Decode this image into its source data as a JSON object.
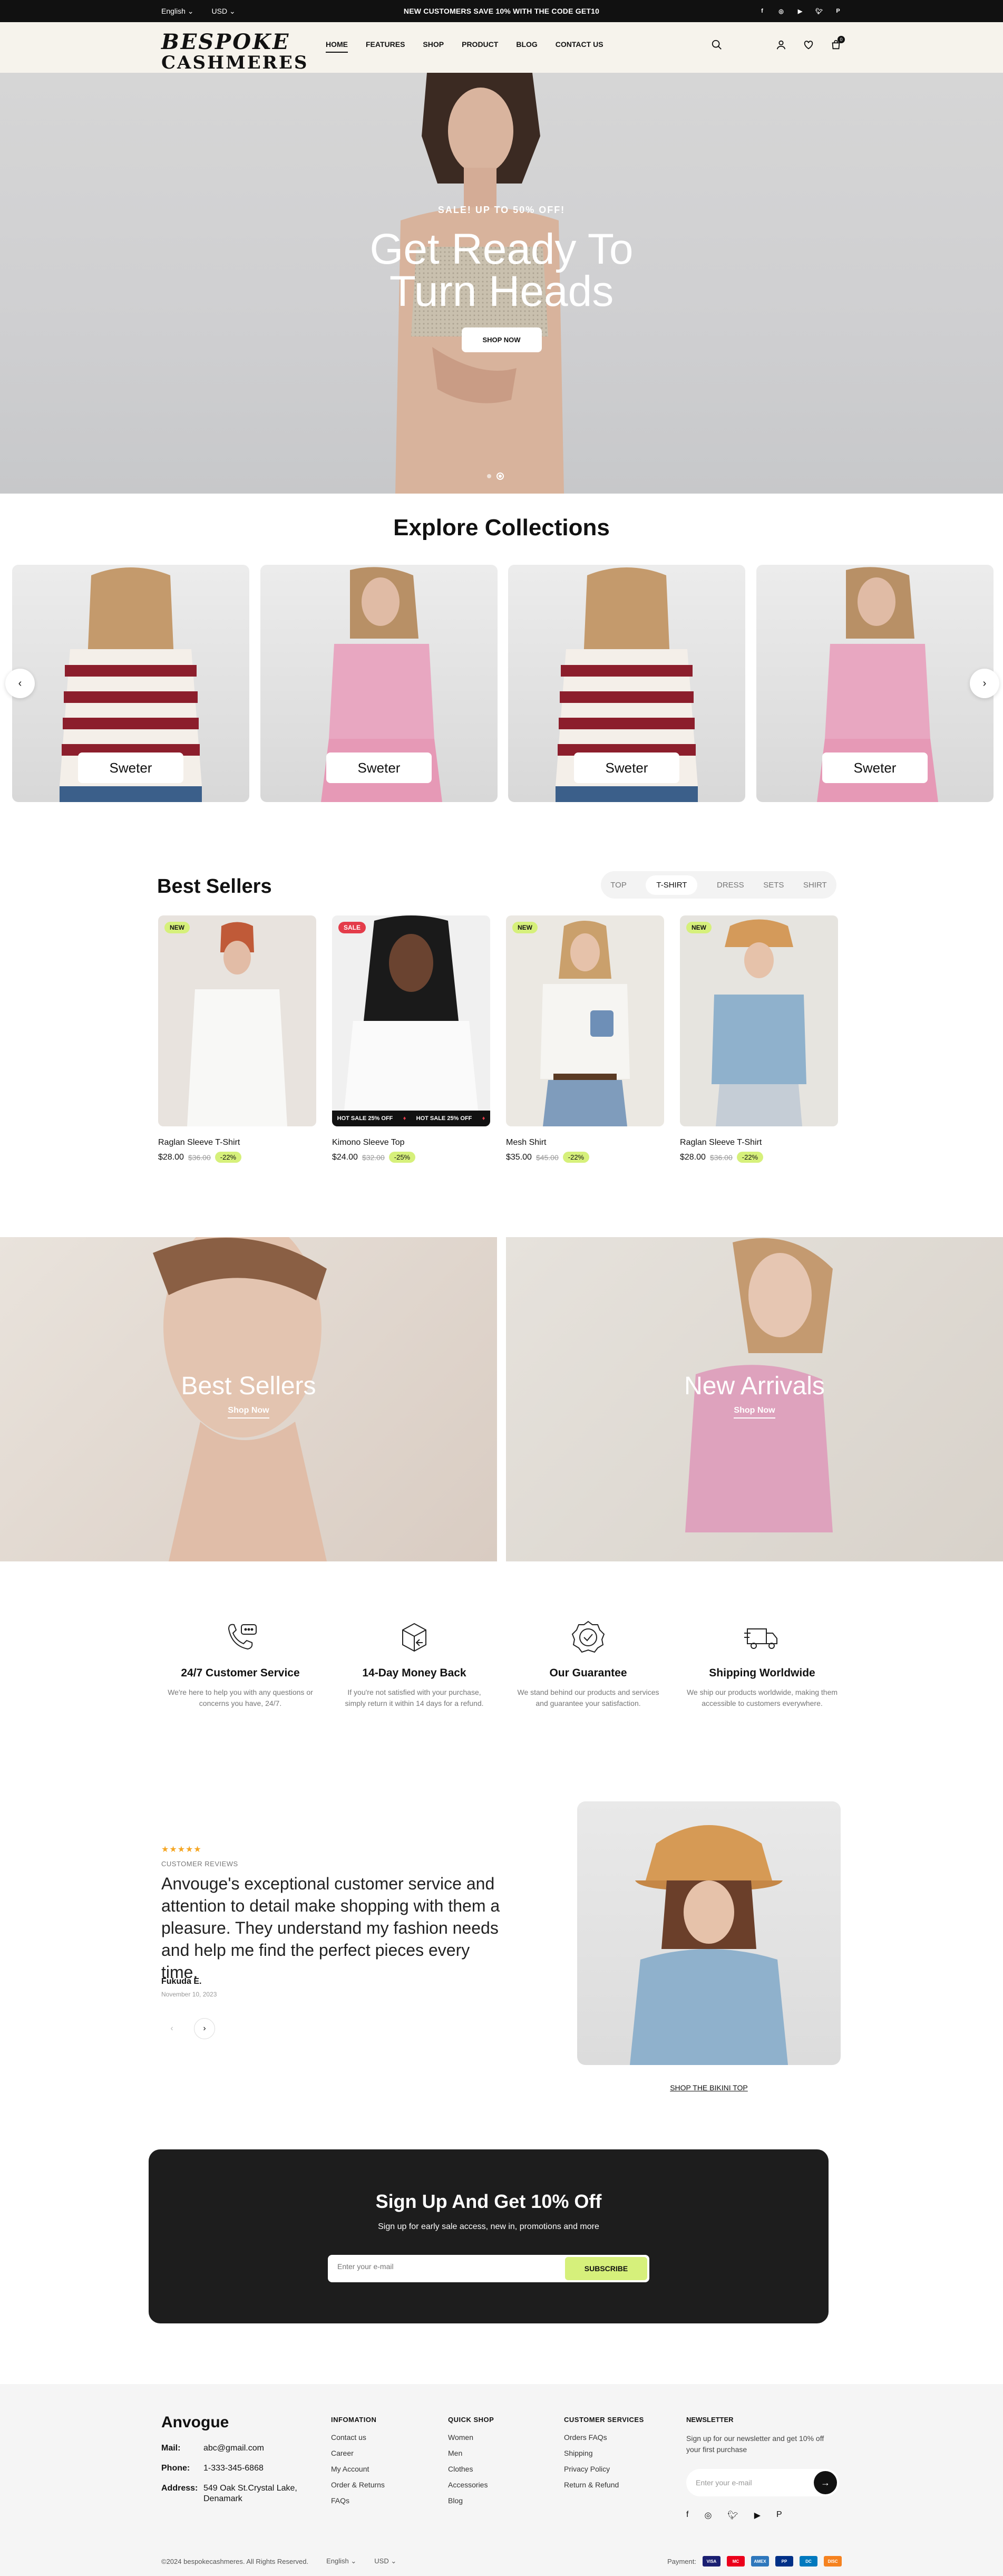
{
  "topbar": {
    "language": "English",
    "currency": "USD",
    "announcement": "NEW CUSTOMERS SAVE 10% WITH THE CODE GET10",
    "social": [
      "facebook-icon",
      "instagram-icon",
      "youtube-icon",
      "twitter-icon",
      "pinterest-icon"
    ]
  },
  "header": {
    "logo_line1": "BESPOKE",
    "logo_line2": "CASHMERES",
    "nav": [
      "HOME",
      "FEATURES",
      "SHOP",
      "PRODUCT",
      "BLOG",
      "CONTACT US"
    ],
    "active_nav": "HOME",
    "cart_count": "0"
  },
  "hero": {
    "subtitle": "SALE! UP TO 50% OFF!",
    "title_line1": "Get Ready To",
    "title_line2": "Turn Heads",
    "cta": "SHOP NOW"
  },
  "collections": {
    "title": "Explore Collections",
    "cards": [
      "Sweter",
      "Sweter",
      "Sweter",
      "Sweter"
    ]
  },
  "best_sellers": {
    "title": "Best Sellers",
    "tabs": [
      "TOP",
      "T-SHIRT",
      "DRESS",
      "SETS",
      "SHIRT"
    ],
    "active_tab": "T-SHIRT",
    "marquee": [
      "HOT SALE 25% OFF",
      "HOT SALE 25% OFF"
    ],
    "products": [
      {
        "badge": "NEW",
        "name": "Raglan Sleeve T-Shirt",
        "price": "$28.00",
        "old_price": "$36.00",
        "discount": "-22%"
      },
      {
        "badge": "SALE",
        "name": "Kimono Sleeve Top",
        "price": "$24.00",
        "old_price": "$32.00",
        "discount": "-25%"
      },
      {
        "badge": "NEW",
        "name": "Mesh Shirt",
        "price": "$35.00",
        "old_price": "$45.00",
        "discount": "-22%"
      },
      {
        "badge": "NEW",
        "name": "Raglan Sleeve T-Shirt",
        "price": "$28.00",
        "old_price": "$36.00",
        "discount": "-22%"
      }
    ]
  },
  "banners": [
    {
      "title": "Best Sellers",
      "link": "Shop Now"
    },
    {
      "title": "New Arrivals",
      "link": "Shop Now"
    }
  ],
  "features": [
    {
      "icon": "headset-chat-icon",
      "title": "24/7 Customer Service",
      "desc1": "We're here to help you with any questions or",
      "desc2": "concerns you have, 24/7."
    },
    {
      "icon": "box-return-icon",
      "title": "14-Day Money Back",
      "desc1": "If you're not satisfied with your purchase,",
      "desc2": "simply return it within 14 days for a refund."
    },
    {
      "icon": "badge-check-icon",
      "title": "Our Guarantee",
      "desc1": "We stand behind our products and services",
      "desc2": "and guarantee your satisfaction."
    },
    {
      "icon": "truck-icon",
      "title": "Shipping Worldwide",
      "desc1": "We ship our products worldwide, making them",
      "desc2": "accessible to customers everywhere."
    }
  ],
  "testimonial": {
    "stars": "★★★★★",
    "label": "CUSTOMER REVIEWS",
    "quote": "Anvouge's exceptional customer service and attention to detail make shopping with them a pleasure. They understand my fashion needs and help me find the perfect pieces every time.",
    "author": "Fukuda E.",
    "date": "November 10, 2023",
    "shop_link": "SHOP THE BIKINI TOP"
  },
  "newsletter": {
    "title": "Sign Up And Get 10% Off",
    "subtitle": "Sign up for early sale access, new in, promotions and more",
    "placeholder": "Enter your e-mail",
    "button": "SUBSCRIBE"
  },
  "footer": {
    "brand": "Anvogue",
    "mail_label": "Mail:",
    "mail": "abc@gmail.com",
    "phone_label": "Phone:",
    "phone": "1-333-345-6868",
    "address_label": "Address:",
    "address1": "549 Oak St.Crystal Lake,",
    "address2": "Denamark",
    "cols": [
      {
        "h": "INFOMATION",
        "items": [
          "Contact us",
          "Career",
          "My Account",
          "Order & Returns",
          "FAQs"
        ]
      },
      {
        "h": "QUICK SHOP",
        "items": [
          "Women",
          "Men",
          "Clothes",
          "Accessories",
          "Blog"
        ]
      },
      {
        "h": "CUSTOMER SERVICES",
        "items": [
          "Orders FAQs",
          "Shipping",
          "Privacy Policy",
          "Return & Refund"
        ]
      }
    ],
    "news_h": "NEWSLETTER",
    "news_d": "Sign up for our newsletter and get 10% off your first purchase",
    "news_placeholder": "Enter your e-mail",
    "copyright": "©2024 bespokecashmeres. All Rights Reserved.",
    "language": "English",
    "currency": "USD",
    "payment_label": "Payment:",
    "payments": [
      "VISA",
      "MC",
      "AMEX",
      "PP",
      "DC",
      "DISC"
    ]
  },
  "colors": {
    "accent": "#d6f07b",
    "sale": "#e43c4a",
    "dark": "#1d1d1d",
    "header_bg": "#f6f3ec"
  }
}
